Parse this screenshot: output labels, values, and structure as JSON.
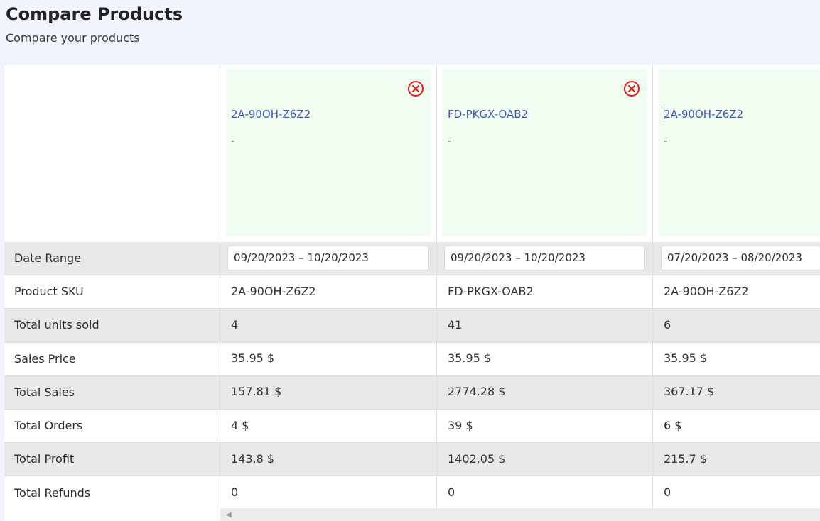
{
  "header": {
    "title": "Compare Products",
    "subtitle": "Compare your products"
  },
  "row_labels": {
    "date_range": "Date Range",
    "product_sku": "Product SKU",
    "total_units_sold": "Total units sold",
    "sales_price": "Sales Price",
    "total_sales": "Total Sales",
    "total_orders": "Total Orders",
    "total_profit": "Total Profit",
    "total_refunds": "Total Refunds"
  },
  "products": [
    {
      "link": "2A-90OH-Z6Z2",
      "subtitle": "-",
      "date_range": "09/20/2023 – 10/20/2023",
      "sku": "2A-90OH-Z6Z2",
      "units_sold": "4",
      "sales_price": "35.95 $",
      "total_sales": "157.81 $",
      "total_orders": "4 $",
      "total_profit": "143.8 $",
      "total_refunds": "0"
    },
    {
      "link": "FD-PKGX-OAB2",
      "subtitle": "-",
      "date_range": "09/20/2023 – 10/20/2023",
      "sku": "FD-PKGX-OAB2",
      "units_sold": "41",
      "sales_price": "35.95 $",
      "total_sales": "2774.28 $",
      "total_orders": "39 $",
      "total_profit": "1402.05 $",
      "total_refunds": "0"
    },
    {
      "link": "2A-90OH-Z6Z2",
      "subtitle": "-",
      "date_range": "07/20/2023 – 08/20/2023",
      "sku": "2A-90OH-Z6Z2",
      "units_sold": "6",
      "sales_price": "35.95 $",
      "total_sales": "367.17 $",
      "total_orders": "6 $",
      "total_profit": "215.7 $",
      "total_refunds": "0"
    }
  ],
  "colors": {
    "accent_link": "#3f51c9",
    "remove_icon": "#e0201b",
    "product_card_bg": "#f2fdf2",
    "row_shade": "#e8e8e8"
  },
  "icons": {
    "remove": "circle-x-icon",
    "scroll_left": "caret-left-icon"
  }
}
